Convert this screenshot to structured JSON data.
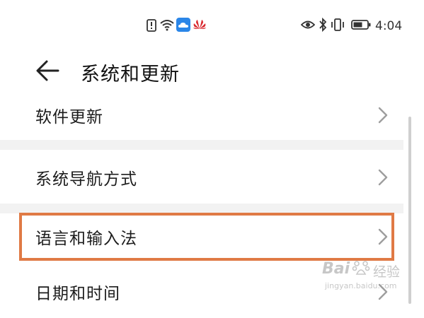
{
  "status_bar": {
    "time": "4:04",
    "left_icons": [
      "alert-icon",
      "wifi-icon",
      "cloud-icon",
      "huawei-logo-icon"
    ],
    "right_icons": [
      "eye-icon",
      "bluetooth-icon",
      "vibrate-icon",
      "battery-icon"
    ]
  },
  "header": {
    "title": "系统和更新",
    "back_icon": "back-arrow-icon"
  },
  "settings": {
    "items": [
      {
        "label": "软件更新"
      },
      {
        "label": "系统导航方式"
      },
      {
        "label": "语言和输入法",
        "highlighted": true
      },
      {
        "label": "日期和时间"
      }
    ]
  },
  "watermark": {
    "brand": "Bai",
    "brand_suffix": "经验",
    "url": "jingyan.baidu.com"
  },
  "colors": {
    "highlight_border": "#e07a45",
    "divider": "#f2f2f2",
    "chevron": "#9e9e9e"
  }
}
